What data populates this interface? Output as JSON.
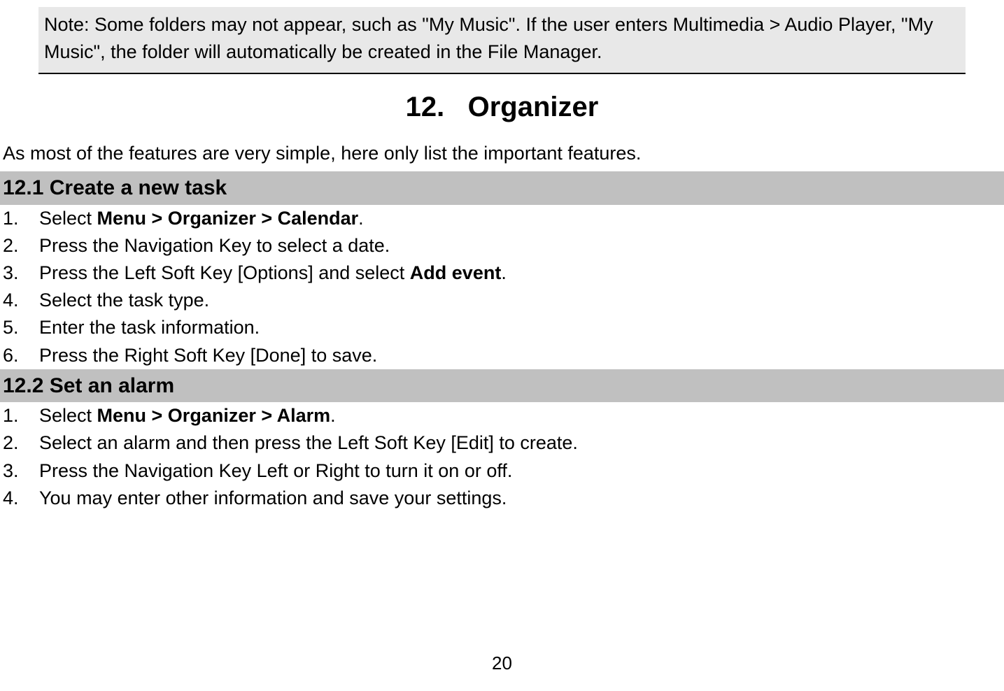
{
  "note": "Note: Some folders may not appear, such as \"My Music\". If the user enters Multimedia > Audio Player, \"My Music\", the folder will automatically be created in the File Manager.",
  "chapter_number": "12.",
  "chapter_title": "Organizer",
  "intro": "As most of the features are very simple, here only list the important features.",
  "section1": {
    "number": "12.1",
    "title": "Create a new task",
    "steps": [
      {
        "num": "1.",
        "pre": "Select ",
        "bold": "Menu > Organizer > Calendar",
        "post": "."
      },
      {
        "num": "2.",
        "pre": "Press the Navigation Key to select a date.",
        "bold": "",
        "post": ""
      },
      {
        "num": "3.",
        "pre": "Press the Left Soft Key [Options] and select ",
        "bold": "Add event",
        "post": "."
      },
      {
        "num": "4.",
        "pre": "Select the task type.",
        "bold": "",
        "post": ""
      },
      {
        "num": "5.",
        "pre": "Enter the task information.",
        "bold": "",
        "post": ""
      },
      {
        "num": "6.",
        "pre": "Press the Right Soft Key [Done] to save.",
        "bold": "",
        "post": ""
      }
    ]
  },
  "section2": {
    "number": "12.2",
    "title": "Set an alarm",
    "steps": [
      {
        "num": "1.",
        "pre": "Select ",
        "bold": "Menu > Organizer > Alarm",
        "post": "."
      },
      {
        "num": "2.",
        "pre": "Select an alarm and then press the Left Soft Key [Edit] to create.",
        "bold": "",
        "post": ""
      },
      {
        "num": "3.",
        "pre": "Press the Navigation Key Left or Right to turn it on or off.",
        "bold": "",
        "post": ""
      },
      {
        "num": "4.",
        "pre": "You may enter other information and save your settings.",
        "bold": "",
        "post": ""
      }
    ]
  },
  "page_number": "20"
}
